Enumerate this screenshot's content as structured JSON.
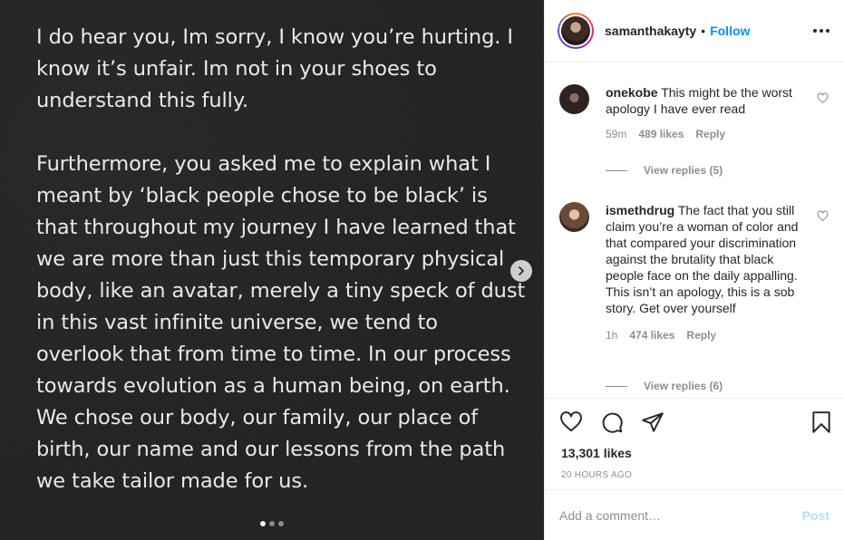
{
  "post": {
    "paragraphs": [
      "I do hear you, Im sorry, I know you’re hurting. I know it’s unfair. Im not in your shoes to understand this fully.",
      "Furthermore, you asked me to explain what I meant by ‘black people chose to be black’  is that throughout my journey I have learned that we are more than just this temporary physical body, like an avatar, merely a tiny speck of dust in this vast infinite universe, we tend to overlook that from time to time. In our process towards evolution as a human being, on earth. We chose our body, our family, our place of birth, our name and our lessons from the path we take tailor made for us."
    ],
    "carousel": {
      "total": 3,
      "active": 1
    }
  },
  "header": {
    "username": "samanthakayty",
    "separator": "•",
    "follow_label": "Follow"
  },
  "comments": [
    {
      "username": "onekobe",
      "text": "This might be the worst apology I have ever read",
      "time": "59m",
      "likes": "489 likes",
      "reply_label": "Reply",
      "view_replies": "View replies (5)"
    },
    {
      "username": "ismethdrug",
      "text": "The fact that you still claim you’re a woman of color and that compared your discrimination against the brutality that black people face on the daily appalling. This isn’t an apology, this is a sob story. Get over yourself",
      "time": "1h",
      "likes": "474 likes",
      "reply_label": "Reply",
      "view_replies": "View replies (6)"
    }
  ],
  "actions": {
    "likes_count": "13,301 likes",
    "time_ago": "20 HOURS AGO",
    "icons": [
      "heart-icon",
      "comment-icon",
      "share-icon",
      "bookmark-icon"
    ]
  },
  "comment_box": {
    "placeholder": "Add a comment…",
    "post_label": "Post"
  },
  "colors": {
    "accent": "#0095f6",
    "post_disabled": "#b2dffc",
    "muted": "#8e8e8e",
    "image_bg": "#232323"
  }
}
